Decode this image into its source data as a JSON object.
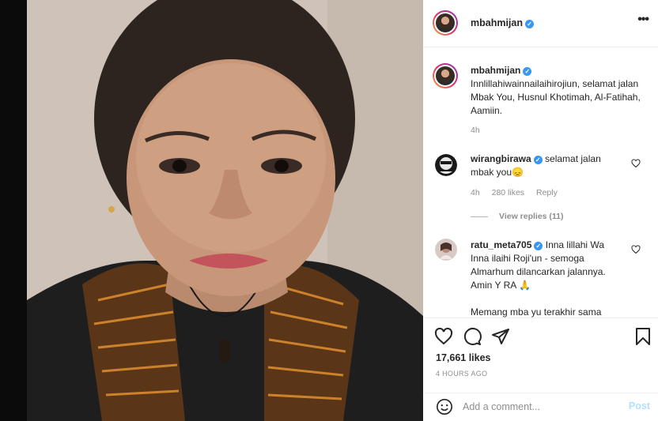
{
  "post": {
    "author": "mbahmijan",
    "caption": {
      "username": "mbahmijan",
      "text": "Innlillahiwainnailaihirojiun, selamat jalan Mbak You, Husnul Khotimah, Al-Fatihah, Aamiin.",
      "age": "4h"
    },
    "comments": [
      {
        "username": "wirangbirawa",
        "text": "selamat jalan mbak you",
        "emoji": "😞",
        "age": "4h",
        "likes": "280 likes",
        "reply": "Reply",
        "view_replies": "View replies (11)"
      },
      {
        "username": "ratu_meta705",
        "text": "Inna lillahi Wa Inna ilaihi Roji'un - semoga Almarhum dilancarkan jalannya. Amin Y RA",
        "emoji": "🙏",
        "text2": "Memang mba yu terakhir sama"
      }
    ],
    "likes": "17,661 likes",
    "timestamp": "4 HOURS AGO",
    "add_comment": {
      "placeholder": "Add a comment...",
      "post_label": "Post"
    }
  },
  "icons": {
    "more": "more-options-icon",
    "like": "heart-icon",
    "comment": "comment-icon",
    "share": "share-icon",
    "save": "bookmark-icon",
    "emoji": "smiley-icon",
    "verified": "verified-badge-icon"
  },
  "colors": {
    "verified": "#3897f0",
    "muted": "#8e8e8e",
    "post_disabled": "#b2dffc"
  }
}
